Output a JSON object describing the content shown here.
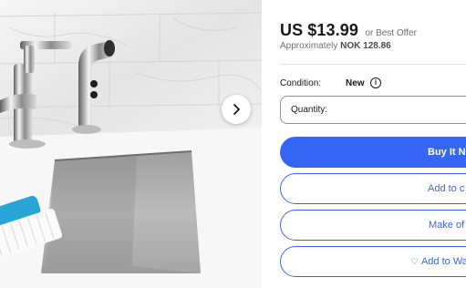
{
  "product": {
    "price": "US $13.99",
    "best_offer": "or Best Offer",
    "approx_prefix": "Approximately",
    "approx_value": "NOK 128.86",
    "condition_label": "Condition:",
    "condition_value": "New",
    "quantity_label": "Quantity:"
  },
  "buttons": {
    "buy_now": "Buy It No",
    "add_to_cart": "Add to c",
    "make_offer": "Make of",
    "add_to_watchlist": "Add to Wa"
  },
  "gallery": {
    "next_icon": "chevron-right-icon"
  },
  "colors": {
    "accent": "#3665f3",
    "text": "#191919",
    "muted": "#707070"
  }
}
